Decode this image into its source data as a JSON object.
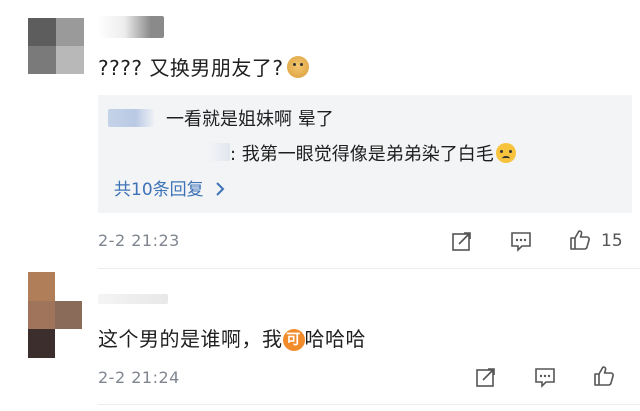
{
  "comments": [
    {
      "text": "???? 又换男朋友了?",
      "emoji": "doge-emoji",
      "replies": [
        {
          "text": "一看就是姐妹啊 晕了"
        },
        {
          "text": ": 我第一眼觉得像是弟弟染了白毛",
          "emoji": "crying-emoji"
        }
      ],
      "more_replies": "共10条回复",
      "more_chevron": ">",
      "timestamp": "2-2 21:23",
      "likes": "15"
    },
    {
      "text_before": "这个男的是谁啊，我",
      "badge": "可",
      "text_after": "哈哈哈",
      "timestamp": "2-2 21:24",
      "likes": ""
    }
  ],
  "colors": {
    "link": "#3d73b6",
    "reply_bg": "#f3f4f6",
    "timestamp": "#7f8690",
    "badge": "#f28b2a"
  }
}
